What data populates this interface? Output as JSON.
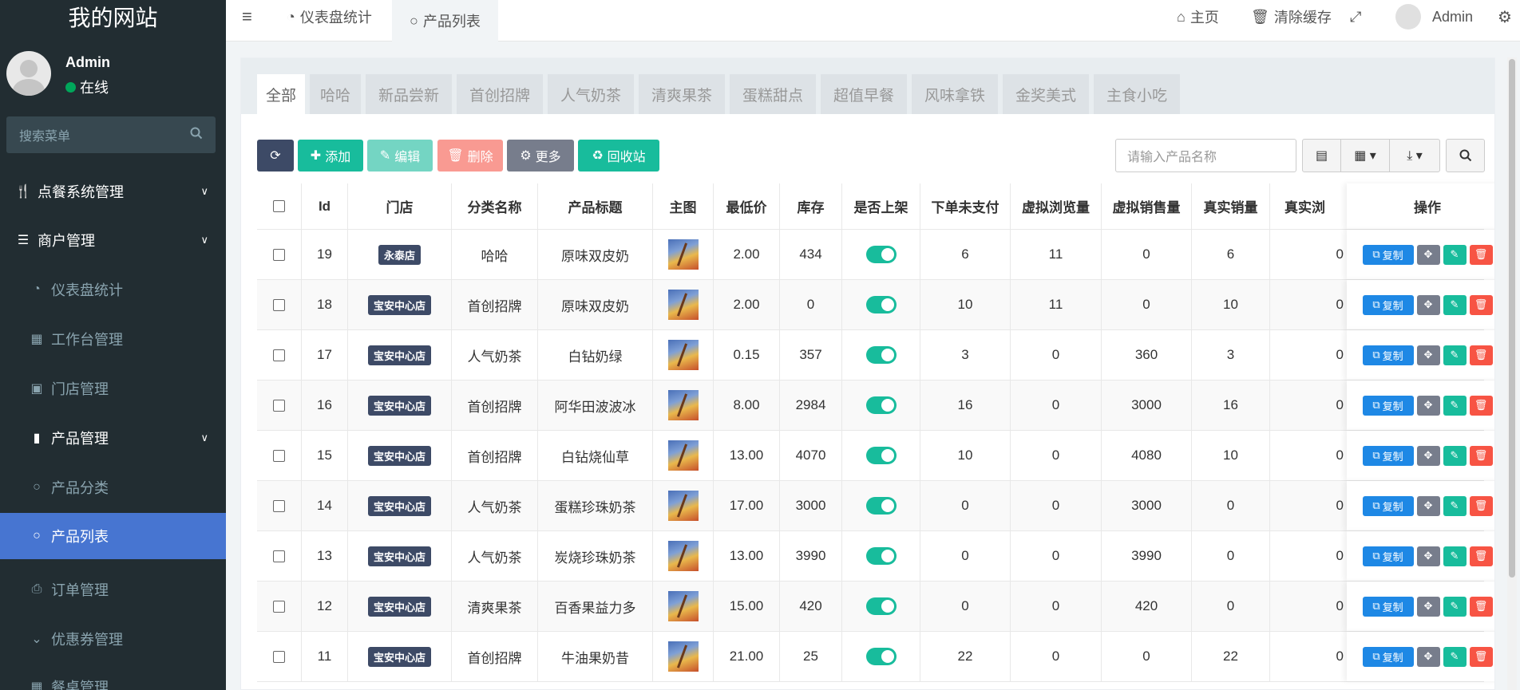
{
  "sidebar": {
    "logo": "我的网站",
    "user": {
      "name": "Admin",
      "status": "在线"
    },
    "search_placeholder": "搜索菜单",
    "menu": {
      "ordering": "点餐系统管理",
      "merchant": "商户管理",
      "dashboard": "仪表盘统计",
      "workbench": "工作台管理",
      "store": "门店管理",
      "product": "产品管理",
      "category": "产品分类",
      "product_list": "产品列表",
      "orders": "订单管理",
      "coupons": "优惠券管理",
      "tables": "餐桌管理"
    }
  },
  "topbar": {
    "tab_dashboard": "仪表盘统计",
    "tab_products": "产品列表",
    "home": "主页",
    "clear_cache": "清除缓存",
    "user": "Admin"
  },
  "category_tabs": [
    "全部",
    "哈哈",
    "新品尝新",
    "首创招牌",
    "人气奶茶",
    "清爽果茶",
    "蛋糕甜点",
    "超值早餐",
    "风味拿铁",
    "金奖美式",
    "主食小吃"
  ],
  "toolbar": {
    "add": "添加",
    "edit": "编辑",
    "delete": "删除",
    "more": "更多",
    "recycle": "回收站",
    "search_placeholder": "请输入产品名称"
  },
  "table": {
    "headers": {
      "id": "Id",
      "store": "门店",
      "category": "分类名称",
      "title": "产品标题",
      "image": "主图",
      "min_price": "最低价",
      "stock": "库存",
      "listed": "是否上架",
      "unpaid": "下单未支付",
      "virtual_views": "虚拟浏览量",
      "virtual_sales": "虚拟销售量",
      "real_sales": "真实销量",
      "real_views": "真实浏",
      "ops": "操作"
    },
    "copy_label": "复制",
    "rows": [
      {
        "id": "19",
        "store": "永泰店",
        "category": "哈哈",
        "title": "原味双皮奶",
        "price": "2.00",
        "stock": "434",
        "unpaid": "6",
        "vviews": "11",
        "vsales": "0",
        "rsales": "6",
        "rviews": "0"
      },
      {
        "id": "18",
        "store": "宝安中心店",
        "category": "首创招牌",
        "title": "原味双皮奶",
        "price": "2.00",
        "stock": "0",
        "unpaid": "10",
        "vviews": "11",
        "vsales": "0",
        "rsales": "10",
        "rviews": "0"
      },
      {
        "id": "17",
        "store": "宝安中心店",
        "category": "人气奶茶",
        "title": "白钻奶绿",
        "price": "0.15",
        "stock": "357",
        "unpaid": "3",
        "vviews": "0",
        "vsales": "360",
        "rsales": "3",
        "rviews": "0"
      },
      {
        "id": "16",
        "store": "宝安中心店",
        "category": "首创招牌",
        "title": "阿华田波波冰",
        "price": "8.00",
        "stock": "2984",
        "unpaid": "16",
        "vviews": "0",
        "vsales": "3000",
        "rsales": "16",
        "rviews": "0"
      },
      {
        "id": "15",
        "store": "宝安中心店",
        "category": "首创招牌",
        "title": "白钻烧仙草",
        "price": "13.00",
        "stock": "4070",
        "unpaid": "10",
        "vviews": "0",
        "vsales": "4080",
        "rsales": "10",
        "rviews": "0"
      },
      {
        "id": "14",
        "store": "宝安中心店",
        "category": "人气奶茶",
        "title": "蛋糕珍珠奶茶",
        "price": "17.00",
        "stock": "3000",
        "unpaid": "0",
        "vviews": "0",
        "vsales": "3000",
        "rsales": "0",
        "rviews": "0"
      },
      {
        "id": "13",
        "store": "宝安中心店",
        "category": "人气奶茶",
        "title": "炭烧珍珠奶茶",
        "price": "13.00",
        "stock": "3990",
        "unpaid": "0",
        "vviews": "0",
        "vsales": "3990",
        "rsales": "0",
        "rviews": "0"
      },
      {
        "id": "12",
        "store": "宝安中心店",
        "category": "清爽果茶",
        "title": "百香果益力多",
        "price": "15.00",
        "stock": "420",
        "unpaid": "0",
        "vviews": "0",
        "vsales": "420",
        "rsales": "0",
        "rviews": "0"
      },
      {
        "id": "11",
        "store": "宝安中心店",
        "category": "首创招牌",
        "title": "牛油果奶昔",
        "price": "21.00",
        "stock": "25",
        "unpaid": "22",
        "vviews": "0",
        "vsales": "0",
        "rsales": "22",
        "rviews": "0"
      }
    ]
  },
  "colors": {
    "sidebar_bg": "#222d32",
    "active_menu": "#4775d1",
    "add_btn": "#18bc9c",
    "delete_btn": "#f75444",
    "refresh_btn": "#3d4a66",
    "copy_btn": "#1e88e5"
  }
}
